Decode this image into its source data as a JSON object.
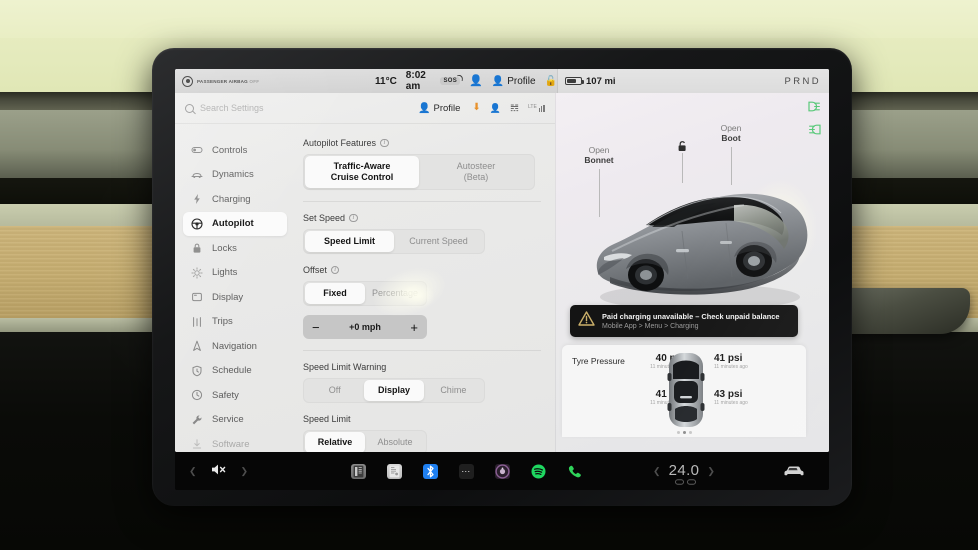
{
  "status_bar": {
    "airbag_label": "PASSENGER AIRBAG",
    "airbag_state": "OFF",
    "temperature": "11°C",
    "time": "8:02 am",
    "sos_label": "SOS",
    "profile_label": "Profile",
    "range": "107 mi",
    "gear_indicator": "PRND",
    "icons": {
      "passenger_airbag": "airbag-icon",
      "sos": "sos-icon",
      "occupant": "person-orange-icon",
      "profile": "person-icon",
      "lock": "lock-open-icon",
      "battery": "battery-icon"
    }
  },
  "search": {
    "placeholder": "Search Settings",
    "profile_label": "Profile",
    "icons": {
      "search": "search-icon",
      "profile": "person-icon",
      "download": "download-icon",
      "user": "user-icon",
      "bluetooth": "bluetooth-icon",
      "signal": "cellular-signal-icon"
    }
  },
  "sidebar": {
    "items": [
      {
        "label": "Controls",
        "icon": "toggle-icon",
        "active": false
      },
      {
        "label": "Dynamics",
        "icon": "car-side-icon",
        "active": false
      },
      {
        "label": "Charging",
        "icon": "bolt-icon",
        "active": false
      },
      {
        "label": "Autopilot",
        "icon": "steering-wheel-icon",
        "active": true
      },
      {
        "label": "Locks",
        "icon": "lock-icon",
        "active": false
      },
      {
        "label": "Lights",
        "icon": "sun-icon",
        "active": false
      },
      {
        "label": "Display",
        "icon": "display-icon",
        "active": false
      },
      {
        "label": "Trips",
        "icon": "route-icon",
        "active": false
      },
      {
        "label": "Navigation",
        "icon": "navigation-arrow-icon",
        "active": false
      },
      {
        "label": "Schedule",
        "icon": "clock-shield-icon",
        "active": false
      },
      {
        "label": "Safety",
        "icon": "clock-icon",
        "active": false
      },
      {
        "label": "Service",
        "icon": "wrench-icon",
        "active": false
      },
      {
        "label": "Software",
        "icon": "download-icon",
        "active": false
      }
    ]
  },
  "settings": {
    "groups": [
      {
        "label": "Autopilot Features",
        "has_info": true,
        "options": [
          {
            "label": "Traffic-Aware\nCruise Control",
            "line1": "Traffic-Aware",
            "line2": "Cruise Control",
            "selected": true
          },
          {
            "label": "Autosteer\n(Beta)",
            "line1": "Autosteer",
            "line2": "(Beta)",
            "selected": false
          }
        ]
      },
      {
        "label": "Set Speed",
        "has_info": true,
        "options": [
          {
            "line1": "Speed Limit",
            "line2": "",
            "selected": true
          },
          {
            "line1": "Current Speed",
            "line2": "",
            "selected": false
          }
        ]
      },
      {
        "label": "Offset",
        "has_info": true,
        "options": [
          {
            "line1": "Fixed",
            "line2": "",
            "selected": true
          },
          {
            "line1": "Percentage",
            "line2": "",
            "selected": false
          }
        ]
      },
      {
        "label": "Speed Limit Warning",
        "has_info": false,
        "options": [
          {
            "line1": "Off",
            "line2": "",
            "selected": false
          },
          {
            "line1": "Display",
            "line2": "",
            "selected": true
          },
          {
            "line1": "Chime",
            "line2": "",
            "selected": false
          }
        ]
      },
      {
        "label": "Speed Limit",
        "has_info": false,
        "options": [
          {
            "line1": "Relative",
            "line2": "",
            "selected": true
          },
          {
            "line1": "Absolute",
            "line2": "",
            "selected": false
          }
        ]
      }
    ],
    "offset_stepper": {
      "minus": "−",
      "value": "+0 mph",
      "plus": "+"
    }
  },
  "car_panel": {
    "headlight_indicators": [
      {
        "icon": "low-beam-icon",
        "color": "#57c878"
      },
      {
        "icon": "fog-light-icon",
        "color": "#57c878"
      }
    ],
    "callouts": [
      {
        "line1": "Open",
        "line2": "Bonnet"
      },
      {
        "line1": "Open",
        "line2": "Boot"
      }
    ],
    "lock_icon": "lock-open-icon",
    "charge_port_icon": "bolt-icon",
    "alert": {
      "icon": "warning-triangle-icon",
      "title": "Paid charging unavailable – Check unpaid balance",
      "subtitle": "Mobile App > Menu > Charging"
    },
    "tyre_pressure": {
      "title": "Tyre Pressure",
      "readings": [
        {
          "position": "front-left",
          "value": "40 psi",
          "age": "11 minutes ago"
        },
        {
          "position": "front-right",
          "value": "41 psi",
          "age": "11 minutes ago"
        },
        {
          "position": "rear-left",
          "value": "41 psi",
          "age": "11 minutes ago"
        },
        {
          "position": "rear-right",
          "value": "43 psi",
          "age": "11 minutes ago"
        }
      ]
    }
  },
  "taskbar": {
    "volume_icon": "speaker-muted-icon",
    "prev_icon": "chevron-left-icon",
    "next_icon": "chevron-right-icon",
    "apps": [
      {
        "icon": "dashcam-icon"
      },
      {
        "icon": "media-card-icon"
      },
      {
        "icon": "bluetooth-icon"
      },
      {
        "icon": "more-dots-icon"
      },
      {
        "icon": "camera-icon"
      },
      {
        "icon": "spotify-icon"
      },
      {
        "icon": "phone-icon"
      }
    ],
    "temperature": "24.0",
    "seat-heater_icon": "seat-heater-icon",
    "car_icon": "car-front-icon",
    "colors": {
      "bluetooth": "#1e7ff0",
      "spotify": "#1ed760",
      "phone": "#2fd45a"
    }
  }
}
